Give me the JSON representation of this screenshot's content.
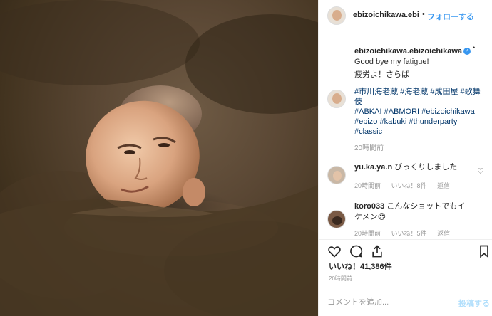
{
  "header": {
    "username": "ebizoichikawa.ebi",
    "separator": "•",
    "follow_label": "フォローする"
  },
  "caption": {
    "username": "ebizoichikawa.ebizoichikawa",
    "verified_icon": "verified-badge-icon",
    "dot": "•",
    "line1": "Good bye my fatigue!",
    "line2": "疲労よ！さらば",
    "hashtags": [
      "#市川海老蔵 #海老蔵 #成田屋 #歌舞",
      "伎",
      "#ABKAI #ABMORI #ebizoichikawa",
      "#ebizo #kabuki #thunderparty",
      "#classic"
    ],
    "time": "20時間前"
  },
  "comments": [
    {
      "username": "yu.ka.ya.n",
      "text": "びっくりしました",
      "time": "20時間前",
      "likes": "いいね！8件",
      "reply": "返信"
    },
    {
      "username": "koro033",
      "text_line1": "こんなショットでもイ",
      "text_line2": "ケメン😍",
      "time": "20時間前",
      "likes": "いいね！5件",
      "reply": "返信"
    }
  ],
  "actions": {
    "like_icon": "heart-icon",
    "comment_icon": "comment-icon",
    "share_icon": "share-icon",
    "save_icon": "bookmark-icon"
  },
  "likes_count": "いいね！41,386件",
  "post_time": "20時間前",
  "comment_box": {
    "placeholder": "コメントを追加...",
    "post_label": "投稿する"
  },
  "colors": {
    "accent": "#3897f0",
    "hashtag": "#003569",
    "muted": "#999999",
    "sand": "#5a4734"
  }
}
